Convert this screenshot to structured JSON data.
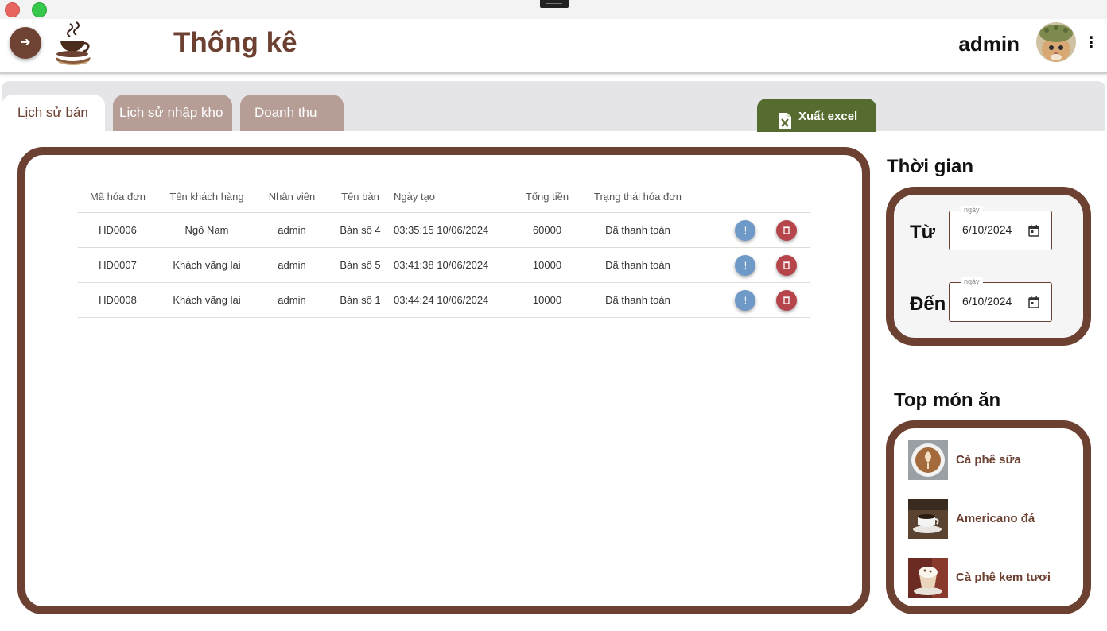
{
  "header": {
    "title": "Thống kê",
    "user_name": "admin",
    "menu_icon": "arrow-right-icon",
    "more_icon": "more-vertical-icon"
  },
  "tabs": [
    {
      "label": "Lịch sử bán",
      "active": true
    },
    {
      "label": "Lịch sử nhập kho",
      "active": false
    },
    {
      "label": "Doanh thu",
      "active": false
    }
  ],
  "export_button": {
    "label": "Xuất excel",
    "icon": "excel-file-icon"
  },
  "table": {
    "columns": [
      "Mã hóa đơn",
      "Tên khách hàng",
      "Nhân viên",
      "Tên bàn",
      "Ngày tạo",
      "Tổng tiền",
      "Trạng thái hóa đơn"
    ],
    "rows": [
      {
        "id": "HD0006",
        "customer": "Ngô Nam",
        "staff": "admin",
        "table": "Bàn số 4",
        "created": "03:35:15 10/06/2024",
        "total": "60000",
        "status": "Đã thanh toán"
      },
      {
        "id": "HD0007",
        "customer": "Khách vãng lai",
        "staff": "admin",
        "table": "Bàn số 5",
        "created": "03:41:38 10/06/2024",
        "total": "10000",
        "status": "Đã thanh toán"
      },
      {
        "id": "HD0008",
        "customer": "Khách vãng lai",
        "staff": "admin",
        "table": "Bàn số 1",
        "created": "03:44:24 10/06/2024",
        "total": "10000",
        "status": "Đã thanh toán"
      }
    ],
    "info_glyph": "!",
    "info_icon": "info-icon",
    "delete_icon": "trash-icon"
  },
  "time_filter": {
    "title": "Thời gian",
    "from_label": "Từ",
    "to_label": "Đến",
    "field_caption": "ngày",
    "from_value": "6/10/2024",
    "to_value": "6/10/2024",
    "calendar_icon": "calendar-icon"
  },
  "top_items": {
    "title": "Top món ăn",
    "items": [
      {
        "name": "Cà phê sữa"
      },
      {
        "name": "Americano đá"
      },
      {
        "name": "Cà phê kem tươi"
      }
    ]
  },
  "colors": {
    "brand_brown": "#6d4132",
    "tab_inactive": "#b69e97",
    "export_green": "#556b2f",
    "info_blue": "#6f9ac7",
    "delete_red": "#b5454a"
  }
}
